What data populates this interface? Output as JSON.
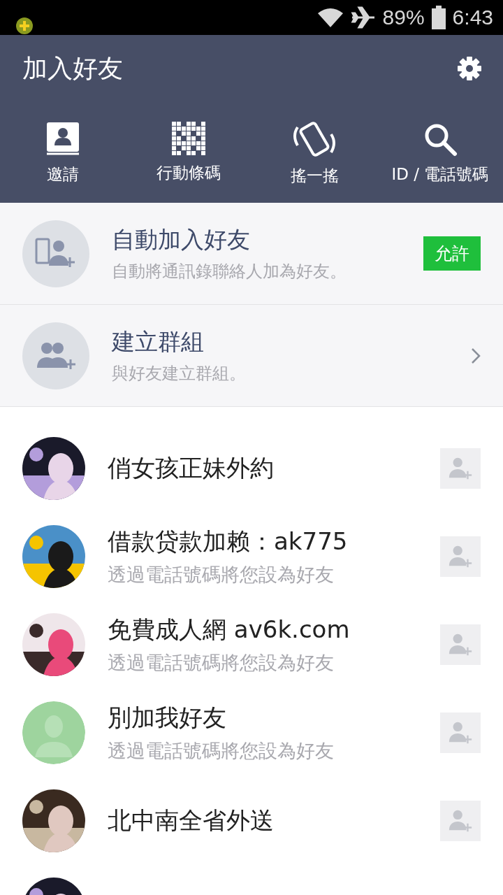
{
  "status_bar": {
    "battery": "89%",
    "time": "6:43"
  },
  "header": {
    "title": "加入好友"
  },
  "actions": [
    {
      "kind": "invite",
      "label": "邀請"
    },
    {
      "kind": "qr",
      "label": "行動條碼"
    },
    {
      "kind": "shake",
      "label": "搖一搖"
    },
    {
      "kind": "search",
      "label": "ID / 電話號碼"
    }
  ],
  "features": [
    {
      "kind": "auto",
      "title": "自動加入好友",
      "subtitle": "自動將通訊錄聯絡人加為好友。",
      "button": "允許"
    },
    {
      "kind": "group",
      "title": "建立群組",
      "subtitle": "與好友建立群組。"
    }
  ],
  "contacts": [
    {
      "name": "俏女孩正妹外約",
      "kind": "picture"
    },
    {
      "name": "借款贷款加赖：ak775",
      "subtitle": "透過電話號碼將您設為好友",
      "kind": "picture"
    },
    {
      "name": "免費成人網 av6k.com",
      "subtitle": "透過電話號碼將您設為好友",
      "kind": "picture"
    },
    {
      "name": "別加我好友",
      "subtitle": "透過電話號碼將您設為好友",
      "kind": "default"
    },
    {
      "name": "北中南全省外送",
      "kind": "picture"
    },
    {
      "kind": "picture"
    }
  ]
}
